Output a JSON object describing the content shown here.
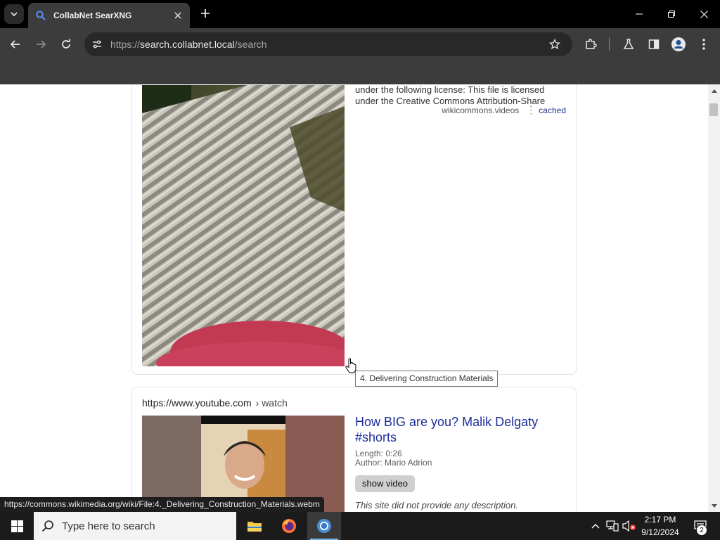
{
  "browser": {
    "tab_title": "CollabNet SearXNG",
    "url_scheme": "https://",
    "url_host": "search.collabnet.local",
    "url_path": "/search"
  },
  "results": {
    "first": {
      "snippet": "under the following license: This file is licensed under the Creative Commons Attribution-Share",
      "engine": "wikicommons.videos",
      "cached_label": "cached",
      "tooltip": "4. Delivering Construction Materials"
    },
    "second": {
      "url": "https://www.youtube.com",
      "path": "› watch",
      "title": "How BIG are you? Malik Delgaty #shorts",
      "length": "Length: 0:26",
      "author": "Author: Mario Adrion",
      "show_video_label": "show video",
      "description": "This site did not provide any description."
    }
  },
  "status_bar": {
    "url": "https://commons.wikimedia.org/wiki/File:4._Delivering_Construction_Materials.webm"
  },
  "taskbar": {
    "search_placeholder": "Type here to search",
    "time": "2:17 PM",
    "date": "9/12/2024",
    "notification_count": "2"
  },
  "colors": {
    "title_link": "#1d2e9a",
    "chrome_dark": "#3c3c3c",
    "accent": "#76b9ed"
  }
}
